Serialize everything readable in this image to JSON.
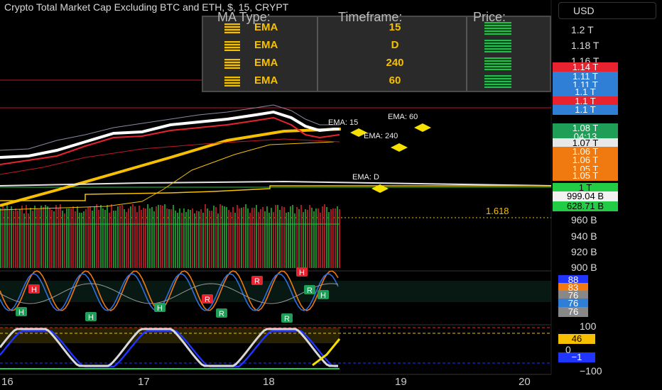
{
  "header": {
    "title": "Crypto Total Market Cap Excluding BTC and ETH, $, 15, CRYPT",
    "currency_button": "USD"
  },
  "ma_table": {
    "headers": [
      "MA Type:",
      "Timeframe:",
      "Price:"
    ],
    "rows": [
      {
        "type": "EMA",
        "timeframe": "15"
      },
      {
        "type": "EMA",
        "timeframe": "D"
      },
      {
        "type": "EMA",
        "timeframe": "240"
      },
      {
        "type": "EMA",
        "timeframe": "60"
      }
    ]
  },
  "price_axis": {
    "labels": [
      "1.2 T",
      "1.18 T",
      "1.16 T",
      "960 B",
      "940 B",
      "920 B",
      "900 B"
    ]
  },
  "price_tags": [
    {
      "text": "1.14 T",
      "color": "#e8222f"
    },
    {
      "text": "1.11 T",
      "color": "#2f7fd6"
    },
    {
      "text": "1.11 T",
      "color": "#2f7fd6"
    },
    {
      "text": "1.1 T",
      "color": "#2f7fd6"
    },
    {
      "text": "1.1 T",
      "color": "#e8222f"
    },
    {
      "text": "1.1 T",
      "color": "#2f7fd6"
    },
    {
      "text": "1.08 T",
      "color": "#1f9e58"
    },
    {
      "text": "04:13",
      "color": "#1f9e58"
    },
    {
      "text": "1.07 T",
      "color": "#e8e8e8",
      "textColor": "#000"
    },
    {
      "text": "1.06 T",
      "color": "#f07a10"
    },
    {
      "text": "1.06 T",
      "color": "#f07a10"
    },
    {
      "text": "1.05 T",
      "color": "#f07a10"
    },
    {
      "text": "1.05 T",
      "color": "#f07a10"
    },
    {
      "text": "1 T",
      "color": "#22cc44",
      "textColor": "#000"
    },
    {
      "text": "999.04 B",
      "color": "#f2f2f2",
      "textColor": "#000"
    },
    {
      "text": "628.71 B",
      "color": "#22cc44",
      "textColor": "#000"
    }
  ],
  "ema_labels": [
    "EMA: 15",
    "EMA: 60",
    "EMA: 240",
    "EMA: D"
  ],
  "fib_label": "1.618",
  "oscillator1": {
    "labels": [
      "88",
      "83",
      "76",
      "76",
      "76"
    ],
    "colors": [
      "#2035ff",
      "#f07a10",
      "#888888",
      "#2f7fd6",
      "#888888"
    ],
    "pivot_marks": [
      "H",
      "L",
      "R"
    ]
  },
  "oscillator2": {
    "axis_labels": [
      "100",
      "0",
      "−100"
    ],
    "tags": [
      {
        "text": "46",
        "color": "#f6c000",
        "textColor": "#000"
      },
      {
        "text": "−1",
        "color": "#2035ff",
        "textColor": "#fff"
      }
    ]
  },
  "x_axis": {
    "labels": [
      "16",
      "17",
      "18",
      "19",
      "20"
    ]
  },
  "chart_data": {
    "type": "line",
    "title": "Crypto Total Market Cap Excluding BTC and ETH, $, 15, CRYPT",
    "xlabel": "",
    "ylabel": "",
    "x": [
      "16",
      "17",
      "18",
      "19",
      "20"
    ],
    "ylim_trillions": [
      0.89,
      1.21
    ],
    "series": [
      {
        "name": "EMA: 15",
        "values_T": [
          1.02,
          1.07,
          1.12,
          null,
          null
        ]
      },
      {
        "name": "EMA: 60",
        "values_T": [
          1.01,
          1.06,
          1.11,
          null,
          null
        ]
      },
      {
        "name": "EMA: 240",
        "values_T": [
          0.97,
          1.03,
          1.07,
          null,
          null
        ]
      },
      {
        "name": "EMA: D",
        "values_T": [
          1.0,
          0.999,
          0.999,
          null,
          null
        ]
      }
    ],
    "annotations": [
      "1.618"
    ],
    "colors": {
      "ema": "#f6c000",
      "price": "#ffffff",
      "up": "#22cc44",
      "down": "#e8222f"
    }
  }
}
